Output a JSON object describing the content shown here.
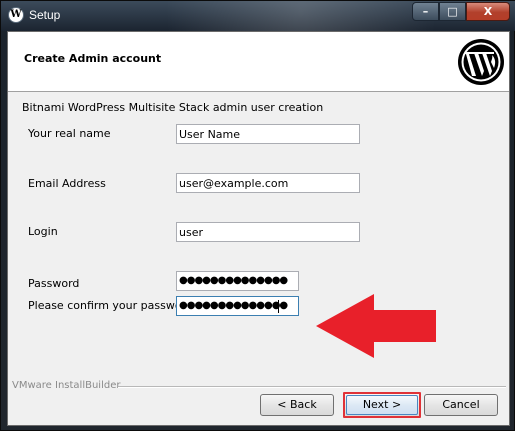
{
  "window": {
    "title": "Setup",
    "buttons": {
      "minimize": "–",
      "maximize": "□",
      "close": "X"
    }
  },
  "header": {
    "title": "Create Admin account",
    "logo_letter": "W"
  },
  "subtitle": "Bitnami WordPress Multisite Stack admin user creation",
  "form": {
    "real_name": {
      "label": "Your real name",
      "value": "User Name"
    },
    "email": {
      "label": "Email Address",
      "value": "user@example.com"
    },
    "login": {
      "label": "Login",
      "value": "user"
    },
    "password": {
      "label": "Password",
      "value": "●●●●●●●●●●●●●●"
    },
    "confirm": {
      "label": "Please confirm your password",
      "value": "●●●●●●●●●●●●●●"
    }
  },
  "footer": {
    "brand": "VMware InstallBuilder",
    "back": "< Back",
    "next": "Next >",
    "cancel": "Cancel"
  },
  "colors": {
    "arrow": "#e8202a",
    "highlight": "#e03237"
  }
}
